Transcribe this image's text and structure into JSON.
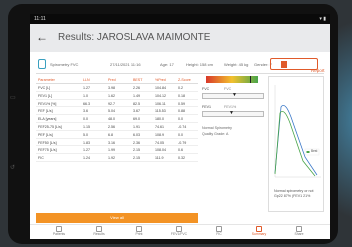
{
  "status": {
    "time": "11:11",
    "indicators": "▾ ▮"
  },
  "header": {
    "back_glyph": "←",
    "title_prefix": "Results:",
    "patient_name": "JAROSLAVA MAIMONTE"
  },
  "info": {
    "test_type": "Spirometry FVC",
    "datetime": "27/11/2021 11:16",
    "age": "Age: 17",
    "height": "Height: 158 cm",
    "weight": "Weight: 45 kg",
    "gender": "Gender: F",
    "report_label": "Report"
  },
  "table": {
    "headers": [
      "Parameter",
      "LLN",
      "Pred",
      "BEST",
      "%Pred",
      "Z-Score"
    ],
    "rows": [
      [
        "FVC [L]",
        "1.27",
        "3.98",
        "2.26",
        "104.84",
        "0.2"
      ],
      [
        "FEV1 [L]",
        "1.0",
        "1.62",
        "1.49",
        "104.12",
        "0.18"
      ],
      [
        "FEV1% [%]",
        "66.3",
        "92.7",
        "82.5",
        "106.11",
        "0.59"
      ],
      [
        "FEF [L/s]",
        "3.6",
        "5.04",
        "3.67",
        "115.53",
        "0.88"
      ],
      [
        "ELA [years]",
        "0.0",
        "48.0",
        "69.0",
        "180.0",
        "0.0"
      ],
      [
        "FEF25-75 [L/s]",
        "1.15",
        "2.56",
        "1.91",
        "74.61",
        "-0.74"
      ],
      [
        "PEF [L/s]",
        "5.0",
        "6.8",
        "6.03",
        "108.9",
        "0.0"
      ],
      [
        "FEF50 [L/s]",
        "1.83",
        "3.16",
        "2.36",
        "74.05",
        "-0.79"
      ],
      [
        "FEF75 [L/s]",
        "1.27",
        "1.99",
        "2.15",
        "108.04",
        "0.6"
      ],
      [
        "FIC",
        "1.24",
        "1.92",
        "2.15",
        "111.9",
        "0.32"
      ]
    ],
    "view_all": "View all"
  },
  "indicators": {
    "fvc_label": "FVC",
    "fvc_sub": "FVC",
    "fev1_label": "FEV1",
    "fev1_sub": "FEV1%",
    "interpretation": "Normal Spirometry",
    "quality": "Quality Grade: A"
  },
  "graph": {
    "note": "Normal spirometry or not Gp22 87% (FEV1 21%",
    "legend": "Best"
  },
  "bottom_nav": [
    {
      "label": "Patients",
      "active": false
    },
    {
      "label": "Results",
      "active": false
    },
    {
      "label": "Print",
      "active": false
    },
    {
      "label": "FEV1/FVC",
      "active": false
    },
    {
      "label": "FIC",
      "active": false
    },
    {
      "label": "Summary",
      "active": true
    },
    {
      "label": "Share",
      "active": false
    }
  ],
  "colors": {
    "accent": "#e05a2a",
    "button": "#f39325",
    "curve_blue": "#3a78c8",
    "curve_green": "#4aa54a"
  }
}
